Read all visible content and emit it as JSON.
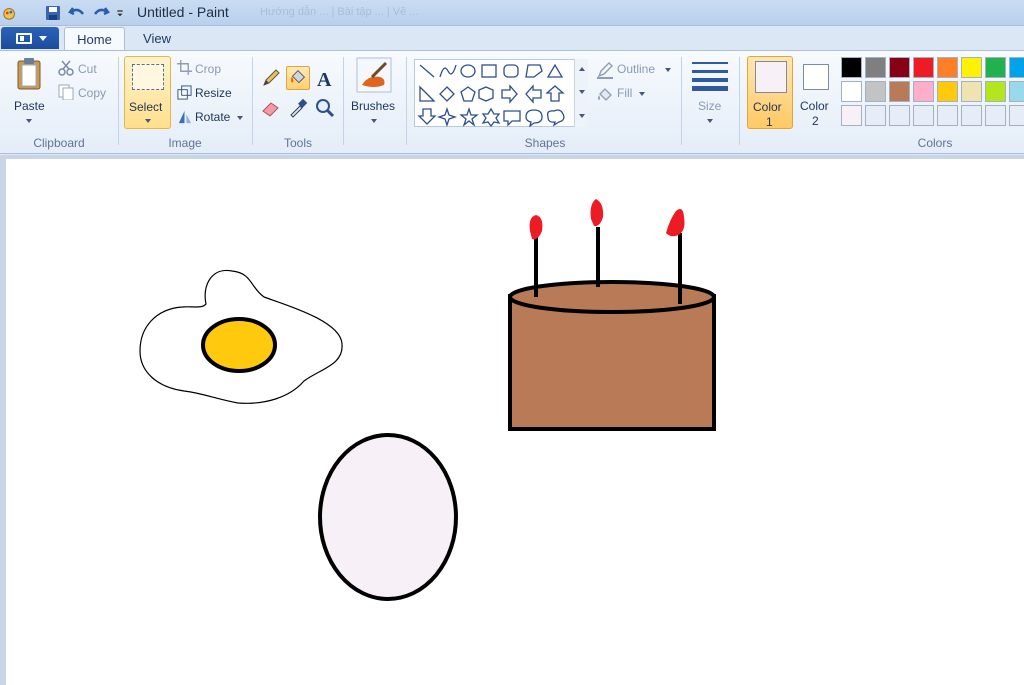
{
  "window": {
    "title": "Untitled - Paint",
    "background_title": "Hướng dẫn ... | Bài tập ... | Vẽ ..."
  },
  "tabs": {
    "home": "Home",
    "view": "View"
  },
  "ribbon": {
    "clipboard": {
      "label": "Clipboard",
      "paste": "Paste",
      "cut": "Cut",
      "copy": "Copy"
    },
    "image": {
      "label": "Image",
      "select": "Select",
      "crop": "Crop",
      "resize": "Resize",
      "rotate": "Rotate"
    },
    "tools": {
      "label": "Tools"
    },
    "brushes": {
      "label": "Brushes"
    },
    "shapes": {
      "label": "Shapes",
      "outline": "Outline",
      "fill": "Fill"
    },
    "size": {
      "label": "Size"
    },
    "colors": {
      "label": "Colors",
      "color1": "Color\n1",
      "color1_line1": "Color",
      "color1_line2": "1",
      "color2_line1": "Color",
      "color2_line2": "2",
      "color1_value": "#f7f0f7",
      "color2_value": "#ffffff",
      "palette_row1": [
        "#000000",
        "#7f7f7f",
        "#880015",
        "#ed1c24",
        "#ff7f27",
        "#fff200",
        "#22b14c",
        "#00a2e8"
      ],
      "palette_row2": [
        "#ffffff",
        "#c3c3c3",
        "#b97a57",
        "#ffaec9",
        "#ffc90e",
        "#efe4b0",
        "#b5e61d",
        "#99d9ea"
      ],
      "palette_row3": [
        "#f7f0f7",
        "#e6edf6",
        "#e6edf6",
        "#e6edf6",
        "#e6edf6",
        "#e6edf6",
        "#e6edf6",
        "#e6edf6"
      ]
    }
  },
  "canvas_drawing": {
    "egg_white_color": "#ffffff",
    "yolk_color": "#ffc90e",
    "cake_color": "#b97a57",
    "flame_color": "#ed1c24",
    "whole_egg_color": "#f7f0f7",
    "outline_color": "#000000"
  }
}
